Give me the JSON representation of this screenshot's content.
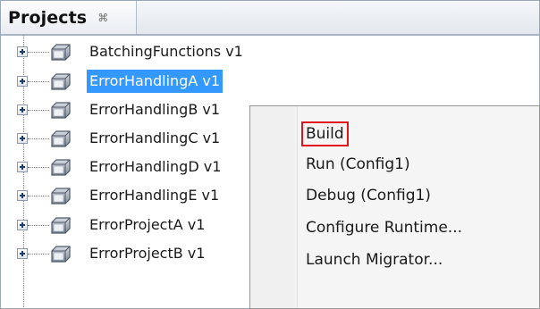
{
  "panel": {
    "title": "Projects",
    "close_glyph": "⌘"
  },
  "tree": {
    "items": [
      {
        "label": "BatchingFunctions v1",
        "selected": false
      },
      {
        "label": "ErrorHandlingA v1",
        "selected": true
      },
      {
        "label": "ErrorHandlingB v1",
        "selected": false
      },
      {
        "label": "ErrorHandlingC v1",
        "selected": false
      },
      {
        "label": "ErrorHandlingD v1",
        "selected": false
      },
      {
        "label": "ErrorHandlingE v1",
        "selected": false
      },
      {
        "label": "ErrorProjectA v1",
        "selected": false
      },
      {
        "label": "ErrorProjectB v1",
        "selected": false
      }
    ]
  },
  "context_menu": {
    "items": [
      {
        "label": "Build",
        "highlighted": true
      },
      {
        "label": "Run (Config1)",
        "highlighted": false
      },
      {
        "label": "Debug (Config1)",
        "highlighted": false
      },
      {
        "label": "Configure Runtime...",
        "highlighted": false
      },
      {
        "label": "Launch Migrator...",
        "highlighted": false
      }
    ]
  },
  "colors": {
    "selection": "#3399ff",
    "highlight_box": "#e0141b"
  },
  "icons": {
    "expander": "plus-expander-icon",
    "project": "project-folder-icon"
  }
}
